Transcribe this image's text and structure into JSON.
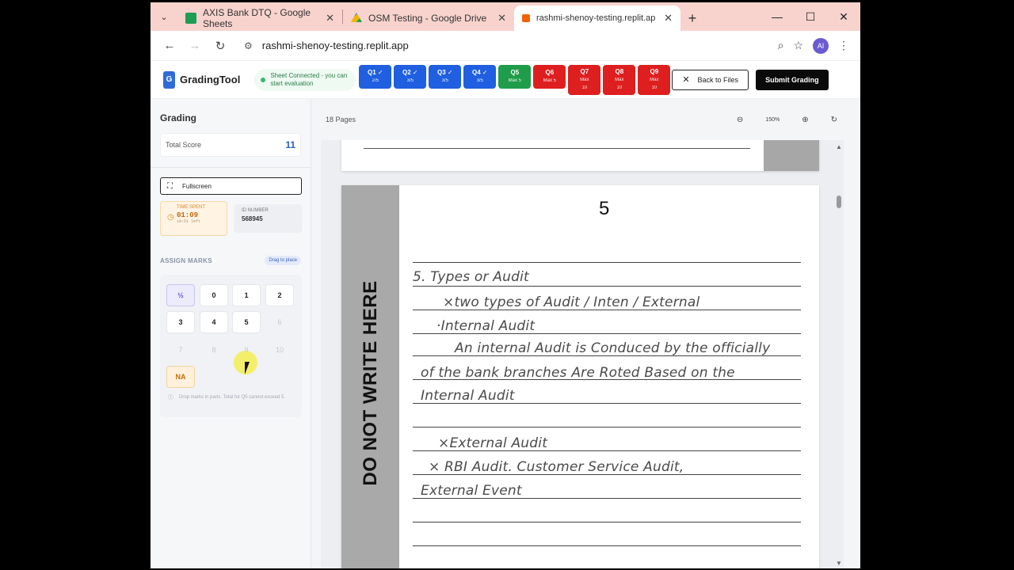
{
  "browser": {
    "tabs": [
      {
        "label": "AXIS Bank DTQ - Google Sheets",
        "icon": "sheets-icon",
        "color": "#1e9e52"
      },
      {
        "label": "OSM Testing - Google Drive",
        "icon": "drive-icon",
        "color": "#f2b400"
      },
      {
        "label": "rashmi-shenoy-testing.replit.ap",
        "icon": "replit-icon",
        "color": "#f26207"
      }
    ],
    "url": "rashmi-shenoy-testing.replit.app",
    "profile_initials": "AI"
  },
  "header": {
    "logo_letter": "G",
    "brand": "GradingTool",
    "sheet_status": "Sheet Connected - you can start evaluation",
    "questions": [
      {
        "label": "Q1",
        "check": "✓",
        "sub": "2/5",
        "state": "done"
      },
      {
        "label": "Q2",
        "check": "✓",
        "sub": "3/5",
        "state": "done"
      },
      {
        "label": "Q3",
        "check": "✓",
        "sub": "3/5",
        "state": "done"
      },
      {
        "label": "Q4",
        "check": "✓",
        "sub": "3/5",
        "state": "done"
      },
      {
        "label": "Q5",
        "check": "",
        "sub": "Max 5",
        "state": "active"
      },
      {
        "label": "Q6",
        "check": "",
        "sub": "Max 5",
        "state": "pending"
      },
      {
        "label": "Q7",
        "check": "",
        "sub": "Max",
        "sub2": "10",
        "state": "pending"
      },
      {
        "label": "Q8",
        "check": "",
        "sub": "Max",
        "sub2": "10",
        "state": "pending"
      },
      {
        "label": "Q9",
        "check": "",
        "sub": "Max",
        "sub2": "10",
        "state": "pending"
      }
    ],
    "back_label": "Back to Files",
    "submit_label": "Submit Grading"
  },
  "sidebar": {
    "title": "Grading",
    "total_score_label": "Total Score",
    "total_score": "11",
    "fullscreen_label": "Fullscreen",
    "time_caption": "TIME SPENT",
    "time_value": "01:09",
    "time_left": "19:51 left",
    "id_caption": "ID NUMBER",
    "id_value": "568945",
    "assign_label": "ASSIGN MARKS",
    "drag_label": "Drag to place",
    "marks": [
      "½",
      "0",
      "1",
      "2",
      "3",
      "4",
      "5",
      "6",
      "7",
      "8",
      "9",
      "10",
      "NA"
    ],
    "marks_enabled": [
      true,
      true,
      true,
      true,
      true,
      true,
      true,
      false,
      false,
      false,
      false,
      false,
      true
    ],
    "note": "Drop marks in parts. Total for Q5 cannot exceed 5."
  },
  "viewer": {
    "pages_label": "18 Pages",
    "zoom": "150%",
    "page_number": "5",
    "margin_text": "DO NOT WRITE HERE",
    "answer_lines": [
      "5.      Types or Audit",
      "×two types of Audit / Inten / External",
      "·Internal Audit",
      "An internal Audit is Conduced by the officially",
      "of the bank branches Are Roted Based on the",
      "Internal Audit",
      "×External Audit",
      "× RBI Audit. Customer Service Audit,",
      "External Event"
    ]
  },
  "colors": {
    "q_done": "#1f5fe0",
    "q_active": "#1f9d4a",
    "q_pending": "#de1f1f",
    "tabstrip": "#f8d3cd"
  }
}
